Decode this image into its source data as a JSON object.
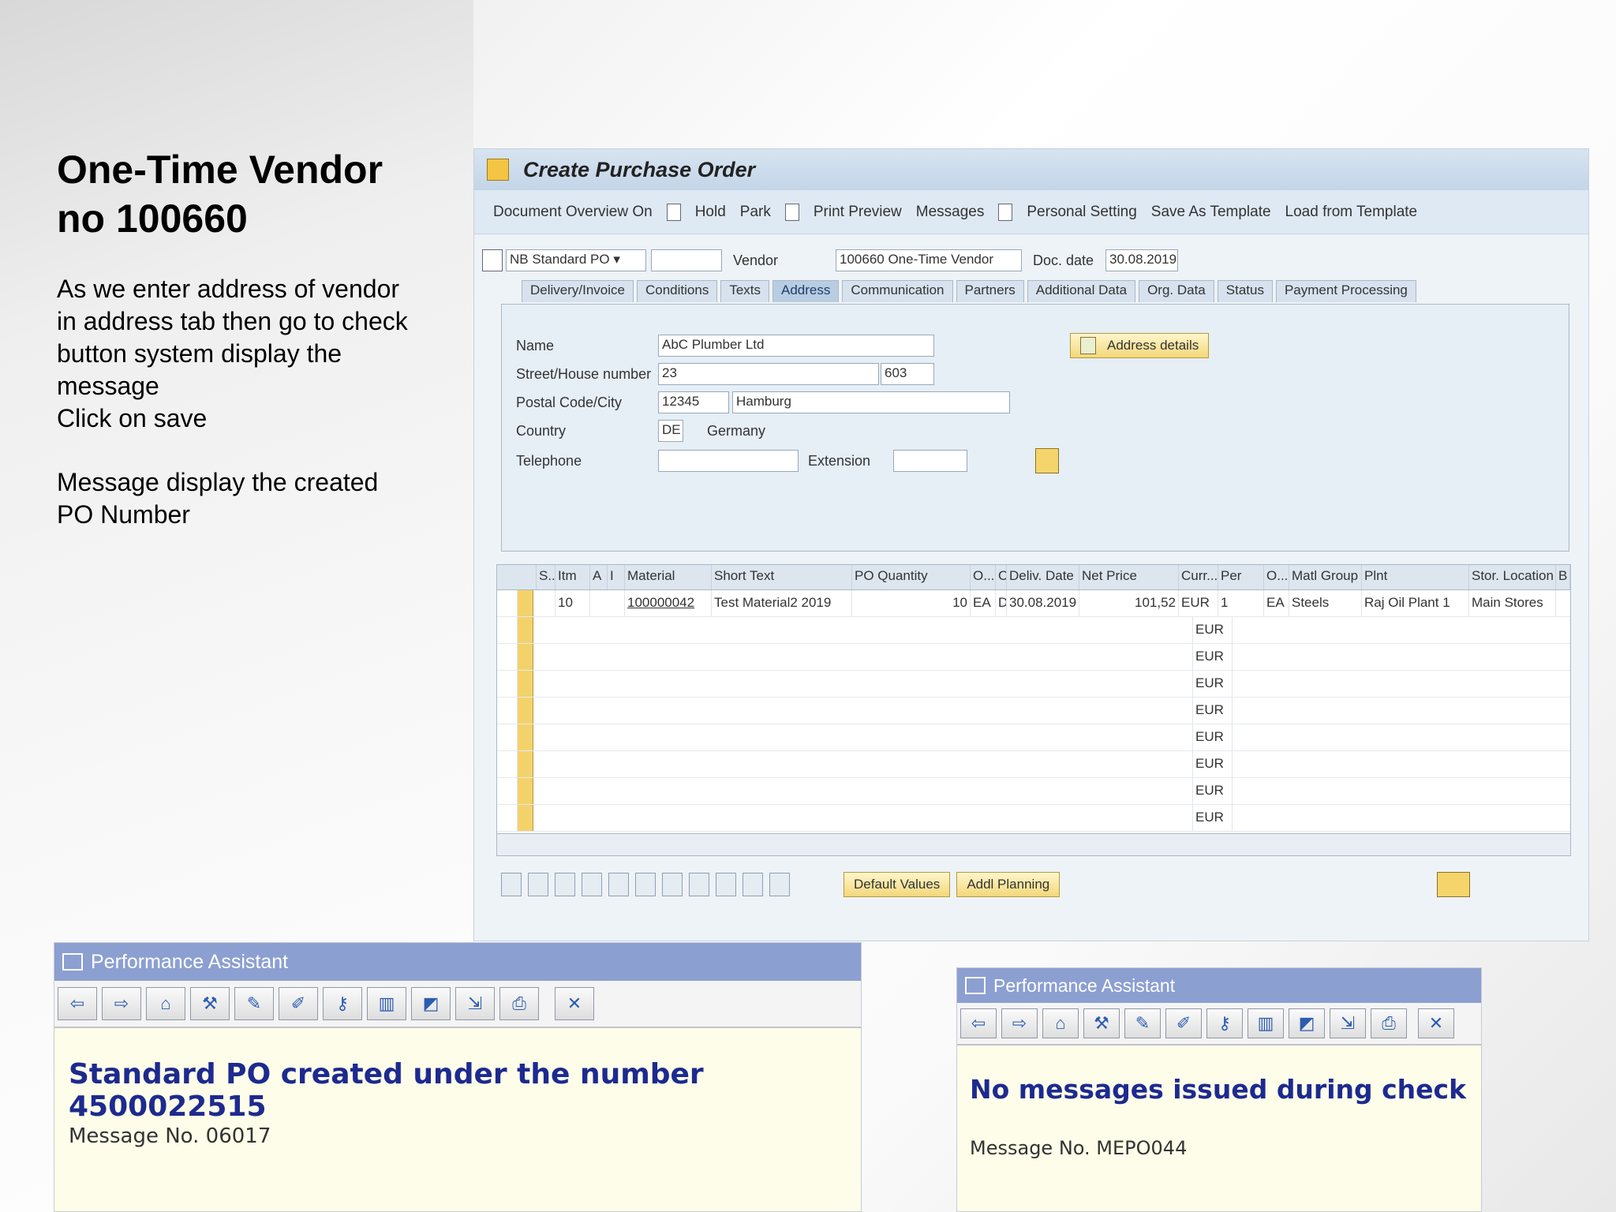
{
  "slide": {
    "title_line1": "One-Time Vendor",
    "title_line2": "no 100660",
    "desc_lines": [
      "As we enter address of vendor",
      "in address tab then go to check",
      "button system display the",
      "message",
      "Click on save"
    ],
    "desc2_lines": [
      "Message display  the created",
      "PO Number"
    ]
  },
  "sap": {
    "title": "Create Purchase Order",
    "toolbar": [
      "Document Overview On",
      "Hold",
      "Park",
      "Print Preview",
      "Messages",
      "Personal Setting",
      "Save As Template",
      "Load from Template"
    ],
    "doc_type": "NB Standard PO",
    "vendor_label": "Vendor",
    "vendor_value": "100660 One-Time Vendor",
    "doc_date_label": "Doc. date",
    "doc_date_value": "30.08.2019",
    "tabs": [
      "Delivery/Invoice",
      "Conditions",
      "Texts",
      "Address",
      "Communication",
      "Partners",
      "Additional Data",
      "Org. Data",
      "Status",
      "Payment Processing"
    ],
    "address": {
      "name_label": "Name",
      "name_value": "AbC Plumber Ltd",
      "street_label": "Street/House number",
      "street_value": "23",
      "house_value": "603",
      "postal_label": "Postal Code/City",
      "postal_value": "12345",
      "city_value": "Hamburg",
      "country_label": "Country",
      "country_value": "DE",
      "country_name": "Germany",
      "telephone_label": "Telephone",
      "extension_label": "Extension",
      "address_details_button": "Address details"
    },
    "grid": {
      "columns": [
        "S..",
        "Itm",
        "A",
        "I",
        "Material",
        "Short Text",
        "PO Quantity",
        "O...",
        "C",
        "Deliv. Date",
        "Net Price",
        "Curr...",
        "Per",
        "O...",
        "Matl Group",
        "Plnt",
        "Stor. Location",
        "B"
      ],
      "row1": {
        "item": "10",
        "material": "100000042",
        "short_text": "Test Material2 2019",
        "qty": "10",
        "unit": "EA",
        "cat": "D",
        "date": "30.08.2019",
        "price": "101,52",
        "curr": "EUR",
        "per": "1",
        "ounit": "EA",
        "matl_group": "Steels",
        "plant": "Raj Oil Plant 1",
        "stor_loc": "Main Stores"
      },
      "empty_curr": "EUR"
    },
    "buttons": {
      "default_values": "Default Values",
      "addl_planning": "Addl Planning"
    }
  },
  "popup_left": {
    "title": "Performance Assistant",
    "message": "Standard PO created under the number 4500022515",
    "message_no": "Message No. 06017"
  },
  "popup_right": {
    "title": "Performance Assistant",
    "message": "No messages issued during check",
    "message_no": "Message No. MEPO044"
  }
}
